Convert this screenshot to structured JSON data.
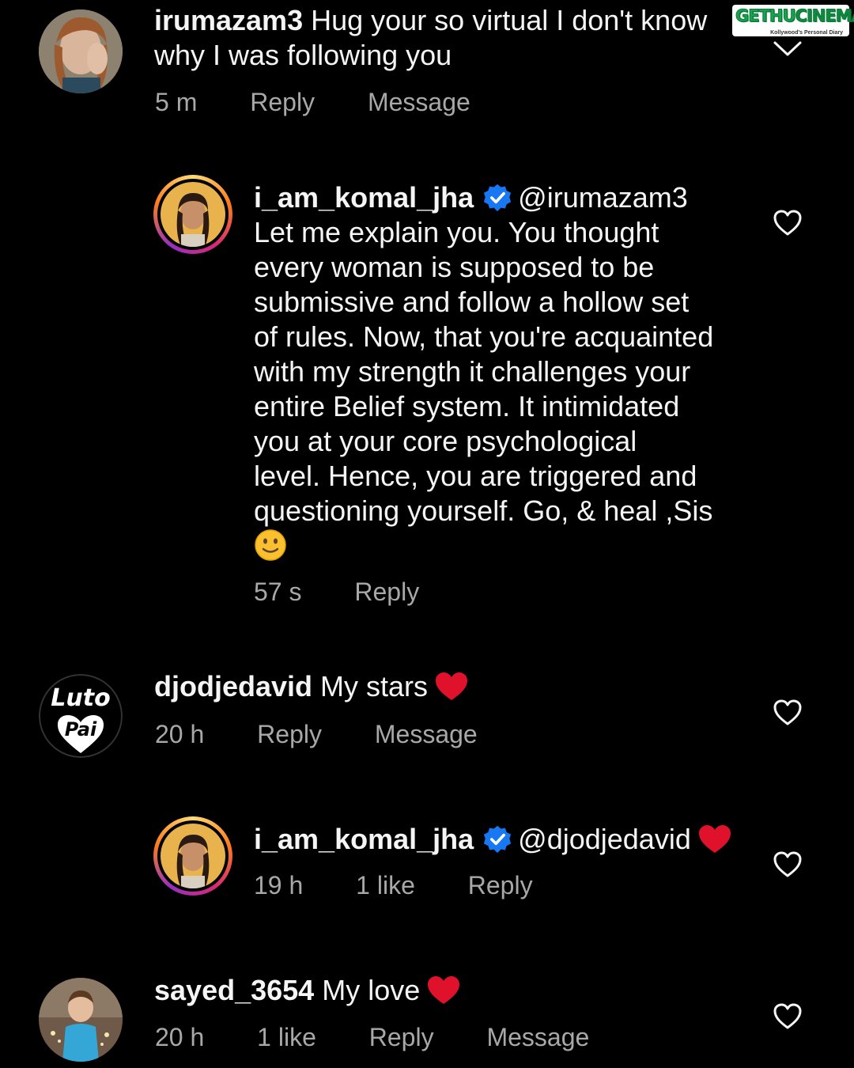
{
  "watermark": {
    "brand_left": "GETHU",
    "brand_right": "CINEMA",
    "tagline": "Kollywood's Personal Diary"
  },
  "comments": [
    {
      "username": "irumazam3",
      "text_line1": "Hug your so virtual I don't know",
      "text_line2": "why I was following you",
      "time": "5 m",
      "reply_label": "Reply",
      "message_label": "Message",
      "avatar_icon": "woman-yawning-photo"
    },
    {
      "username": "i_am_komal_jha",
      "verified": true,
      "mention": "@irumazam3",
      "lines": [
        "Let me explain you. You thought",
        "every woman is supposed to be",
        "submissive and follow a hollow set",
        "of rules. Now, that you're acquainted",
        "with my strength it challenges your",
        "entire Belief system. It intimidated",
        "you at your core psychological",
        "level. Hence, you are triggered and",
        "questioning yourself. Go, & heal ,Sis"
      ],
      "emoji": "slightly-smiling-face",
      "time": "57 s",
      "reply_label": "Reply"
    },
    {
      "username": "djodjedavid",
      "text": "My stars",
      "emoji": "red-heart",
      "time": "20 h",
      "reply_label": "Reply",
      "message_label": "Message",
      "avatar_text_top": "Luto",
      "avatar_text_bottom": "Pai"
    },
    {
      "username": "i_am_komal_jha",
      "verified": true,
      "mention": "@djodjedavid",
      "emoji": "red-heart",
      "time": "19 h",
      "likes": "1 like",
      "reply_label": "Reply"
    },
    {
      "username": "sayed_3654",
      "text": "My love",
      "emoji": "red-heart",
      "time": "20 h",
      "likes": "1 like",
      "reply_label": "Reply",
      "message_label": "Message",
      "avatar_icon": "child-photo"
    }
  ],
  "colors": {
    "background": "#000000",
    "text": "#f5f5f5",
    "meta": "#a8a8a8",
    "verified": "#1877f2",
    "heart": "#e0112b"
  }
}
